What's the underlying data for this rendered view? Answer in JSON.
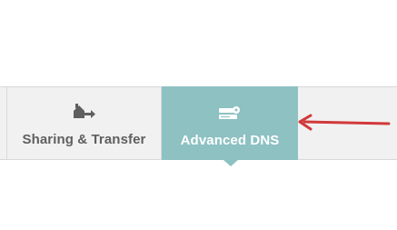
{
  "tabs": [
    {
      "label": "Sharing & Transfer",
      "icon": "house-arrow-icon",
      "active": false
    },
    {
      "label": "Advanced DNS",
      "icon": "server-gear-icon",
      "active": true
    }
  ],
  "colors": {
    "active_tab_bg": "#8dc1c2",
    "inactive_tab_text": "#5f5f5f",
    "active_tab_text": "#ffffff",
    "tab_bar_bg": "#f1f1f1",
    "annotation_arrow": "#d1393b"
  }
}
